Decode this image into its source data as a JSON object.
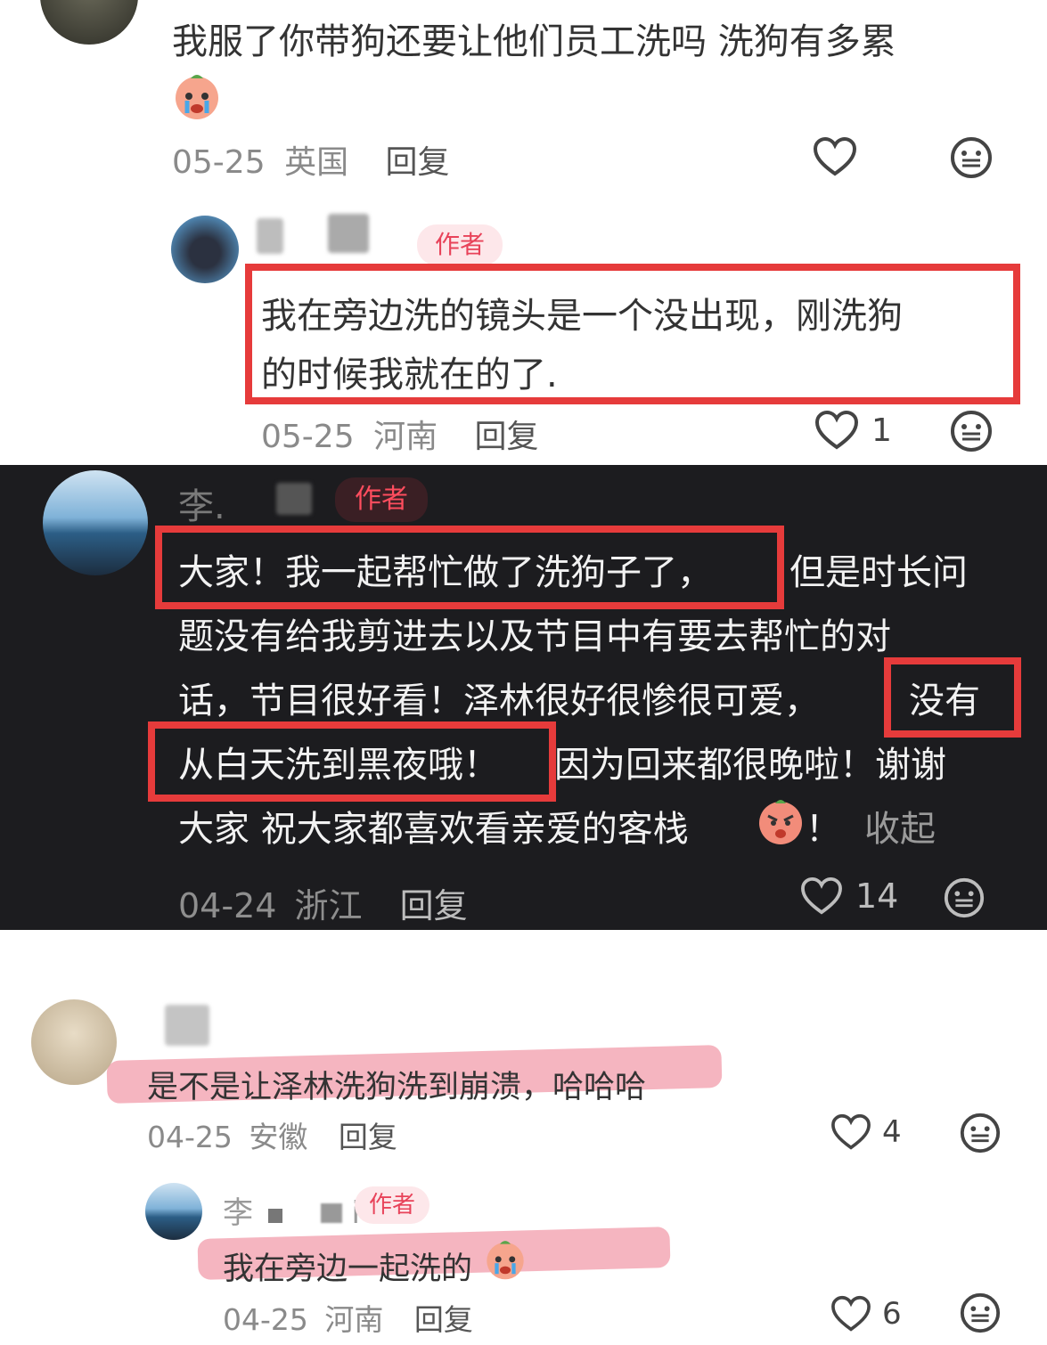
{
  "comment1": {
    "text": "我服了你带狗还要让他们员工洗吗 洗狗有多累",
    "date": "05-25",
    "location": "英国",
    "reply_label": "回复"
  },
  "reply1": {
    "badge": "作者",
    "line1": "我在旁边洗的镜头是一个没出现，刚洗狗",
    "line2": "的时候我就在的了.",
    "date": "05-25",
    "location": "河南",
    "reply_label": "回复",
    "likes": "1"
  },
  "comment2": {
    "username": "李.",
    "badge": "作者",
    "line1a": "大家！我一起帮忙做了洗狗子了，",
    "line1b": "但是时长问",
    "line2": "题没有给我剪进去以及节目中有要去帮忙的对",
    "line3a": "话，节目很好看！泽林很好很惨很可爱，",
    "line3b": "没有",
    "line4a": "从白天洗到黑夜哦！",
    "line4b": "因为回来都很晚啦！谢谢",
    "line5a": "大家 祝大家都喜欢看亲爱的客栈",
    "line5b": "！",
    "collapse": "收起",
    "date": "04-24",
    "location": "浙江",
    "reply_label": "回复",
    "likes": "14"
  },
  "comment3": {
    "text": "是不是让泽林洗狗洗到崩溃，哈哈哈",
    "date": "04-25",
    "location": "安徽",
    "reply_label": "回复",
    "likes": "4"
  },
  "reply3": {
    "username_a": "李",
    "username_b": "i",
    "badge": "作者",
    "text": "我在旁边一起洗的",
    "date": "04-25",
    "location": "河南",
    "reply_label": "回复",
    "likes": "6"
  },
  "colors": {
    "highlight_box": "#e63b3b",
    "author_badge": "#e8435a",
    "dark_bg": "#1c1c1f"
  },
  "icons": [
    "heart-icon",
    "neutral-face-icon",
    "crying-emoji-icon",
    "angry-emoji-icon"
  ]
}
